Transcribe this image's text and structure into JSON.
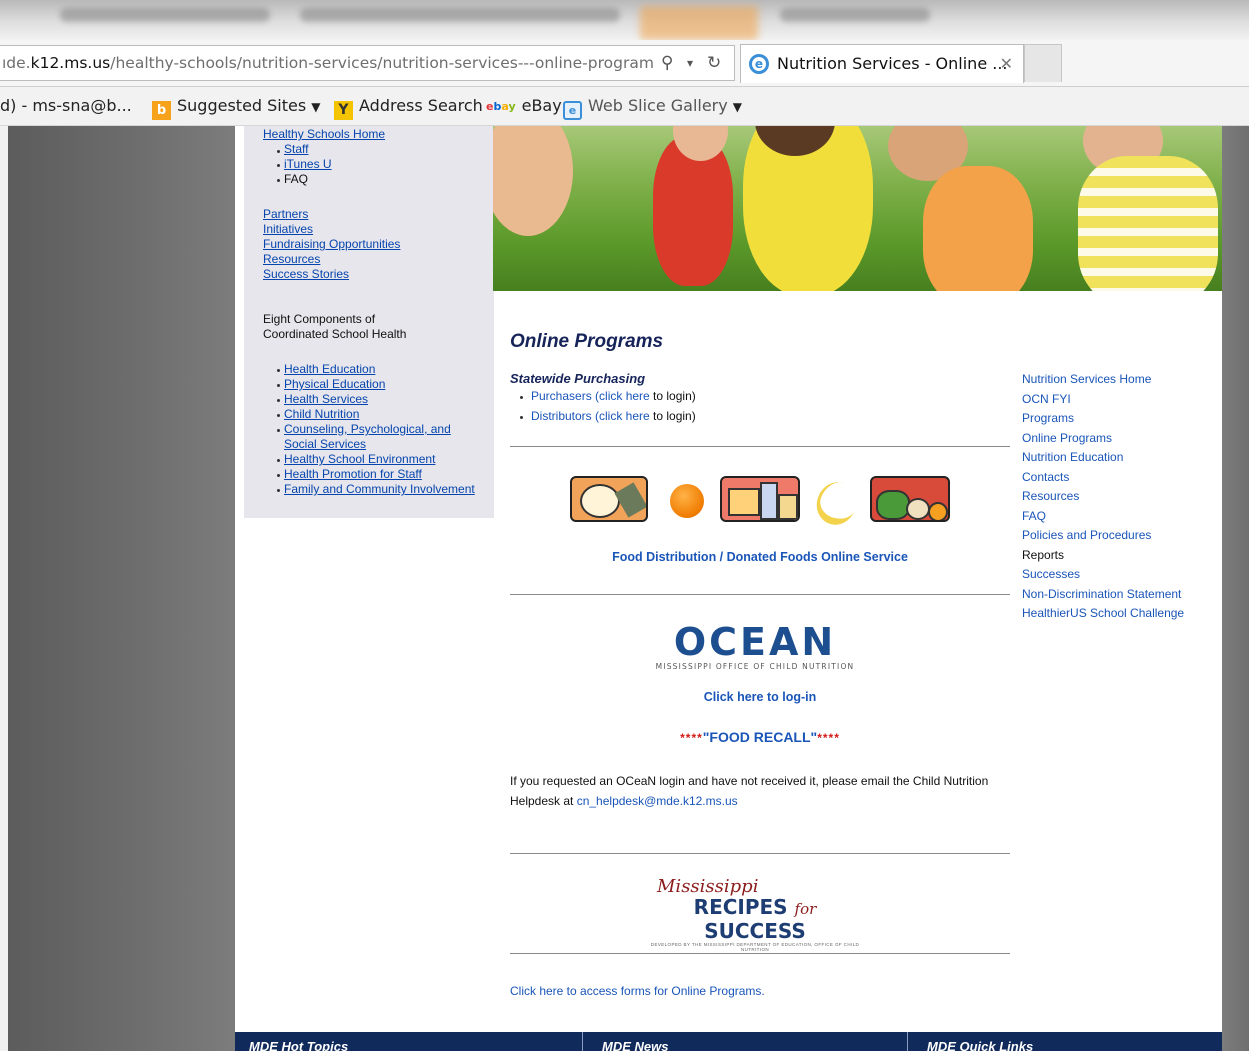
{
  "browser": {
    "url_prefix": "ıde.",
    "url_domain": "k12.ms.us",
    "url_path": "/healthy-schools/nutrition-services/nutrition-services---online-program",
    "tab_title": "Nutrition Services - Online ...",
    "favorites": {
      "account": "d) - ms-sna@b...",
      "suggested_sites": "Suggested Sites",
      "address_search": "Address Search",
      "ebay": "eBay",
      "web_slice_gallery": "Web Slice Gallery"
    }
  },
  "left_nav": {
    "home": "Healthy Schools Home",
    "sub_items": [
      "Staff",
      "iTunes U",
      "FAQ"
    ],
    "links": [
      "Partners",
      "Initiatives",
      "Fundraising Opportunities",
      "Resources",
      "Success Stories"
    ],
    "components_heading_1": "Eight Components of",
    "components_heading_2": "Coordinated School Health",
    "components": [
      "Health Education",
      "Physical Education",
      "Health Services",
      "Child Nutrition",
      "Counseling, Psychological, and",
      "Social Services",
      "Healthy School Environment",
      "Health Promotion for Staff",
      "Family and Community Involvement"
    ]
  },
  "main": {
    "title": "Online Programs",
    "statewide_purchasing": "Statewide Purchasing",
    "purchasers_link": "Purchasers (click here",
    "purchasers_suffix": " to login)",
    "distributors_link": "Distributors (click here",
    "distributors_suffix": " to login)",
    "food_distribution_link": "Food Distribution / Donated Foods Online Service",
    "ocean_logo_text": "OCEAN",
    "ocean_logo_sub": "MISSISSIPPI OFFICE OF CHILD NUTRITION",
    "ocean_login": "Click here to log-in",
    "recall_stars": "****",
    "recall_text": "\"FOOD RECALL\"",
    "notice_text": "If you requested an OCeaN login and have not received it, please email the Child Nutrition Helpdesk at ",
    "helpdesk_email": "cn_helpdesk@mde.k12.ms.us",
    "recipes_script": "Mississippi",
    "recipes_word": "RECIPES",
    "recipes_for": "for",
    "recipes_success": "SUCCESS",
    "recipes_small": "DEVELOPED BY THE MISSISSIPPI DEPARTMENT OF EDUCATION, OFFICE OF CHILD NUTRITION",
    "forms_link": "Click here to access forms for Online Programs."
  },
  "right_nav": [
    {
      "label": "Nutrition Services Home",
      "link": true
    },
    {
      "label": "OCN FYI",
      "link": true
    },
    {
      "label": "Programs",
      "link": true
    },
    {
      "label": "Online Programs",
      "link": true
    },
    {
      "label": "Nutrition Education",
      "link": true
    },
    {
      "label": "Contacts",
      "link": true
    },
    {
      "label": "Resources",
      "link": true
    },
    {
      "label": "FAQ",
      "link": true
    },
    {
      "label": "Policies and Procedures",
      "link": true
    },
    {
      "label": "Reports",
      "link": false
    },
    {
      "label": "Successes",
      "link": true
    },
    {
      "label": "Non-Discrimination Statement",
      "link": true
    },
    {
      "label": "HealthierUS School Challenge",
      "link": true
    }
  ],
  "footer": {
    "col1": "MDE Hot Topics",
    "col2": "MDE News",
    "col3": "MDE Quick Links"
  },
  "colors": {
    "link_blue": "#1a55b8",
    "title_navy": "#16245a",
    "recall_red": "#d21a1a",
    "footer_navy": "#102a5c"
  }
}
